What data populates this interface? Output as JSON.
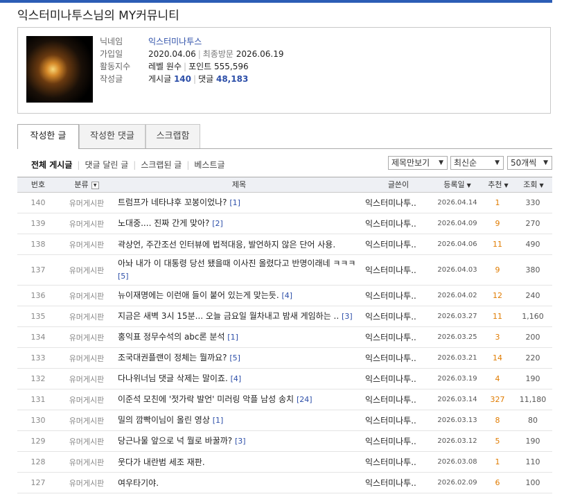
{
  "page_title": "익스터미나투스님의 MY커뮤니티",
  "profile": {
    "nickname_label": "닉네임",
    "nickname": "익스터미나투스",
    "joined_label": "가입일",
    "joined": "2020.04.06",
    "last_visit_label": "최종방문",
    "last_visit": "2026.06.19",
    "activity_label": "활동지수",
    "level_label": "레벨",
    "level": "원수",
    "points_label": "포인트",
    "points": "555,596",
    "writing_label": "작성글",
    "posts_label": "게시글",
    "posts": "140",
    "comments_label": "댓글",
    "comments": "48,183"
  },
  "tabs": [
    "작성한 글",
    "작성한 댓글",
    "스크랩함"
  ],
  "filters": [
    "전체 게시글",
    "댓글 달린 글",
    "스크랩된 글",
    "베스트글"
  ],
  "selects": {
    "view": "제목만보기",
    "sort": "최신순",
    "per_page": "50개씩"
  },
  "columns": {
    "num": "번호",
    "category": "분류",
    "title": "제목",
    "author": "글쓴이",
    "date": "등록일",
    "recommend": "추천",
    "views": "조회"
  },
  "rows": [
    {
      "num": "140",
      "category": "유머게시판",
      "title": "트럼프가 네타냐후 꼬봉이었나?",
      "comments": "[1]",
      "author": "익스터미나투..",
      "date": "2026.04.14",
      "rec": "1",
      "views": "330"
    },
    {
      "num": "139",
      "category": "유머게시판",
      "title": "노대중.... 진짜 간게 맞아?",
      "comments": "[2]",
      "author": "익스터미나투..",
      "date": "2026.04.09",
      "rec": "9",
      "views": "270"
    },
    {
      "num": "138",
      "category": "유머게시판",
      "title": "곽상언, 주간조선 인터뷰에 법적대응, 발언하지 않은 단어 사용.",
      "comments": "",
      "author": "익스터미나투..",
      "date": "2026.04.06",
      "rec": "11",
      "views": "490"
    },
    {
      "num": "137",
      "category": "유머게시판",
      "title": "아놔 내가 이 대통령 당선 됐을때 이사진 올렸다고 반명이래네 ㅋㅋㅋ",
      "comments": "[5]",
      "author": "익스터미나투..",
      "date": "2026.04.03",
      "rec": "9",
      "views": "380"
    },
    {
      "num": "136",
      "category": "유머게시판",
      "title": "뉴이재명에는 이런애 들이 붙어 있는게 맞는듯.",
      "comments": "[4]",
      "author": "익스터미나투..",
      "date": "2026.04.02",
      "rec": "12",
      "views": "240"
    },
    {
      "num": "135",
      "category": "유머게시판",
      "title": "지금은 새벽 3시 15분... 오늘 금요일 월차내고 밤새 게임하는 ..",
      "comments": "[3]",
      "author": "익스터미나투..",
      "date": "2026.03.27",
      "rec": "11",
      "views": "1,160"
    },
    {
      "num": "134",
      "category": "유머게시판",
      "title": "홍익표 정무수석의 abc론 분석",
      "comments": "[1]",
      "author": "익스터미나투..",
      "date": "2026.03.25",
      "rec": "3",
      "views": "200"
    },
    {
      "num": "133",
      "category": "유머게시판",
      "title": "조국대권플랜이 정체는 뭘까요?",
      "comments": "[5]",
      "author": "익스터미나투..",
      "date": "2026.03.21",
      "rec": "14",
      "views": "220"
    },
    {
      "num": "132",
      "category": "유머게시판",
      "title": "다나위너님 댓글 삭제는 말이죠.",
      "comments": "[4]",
      "author": "익스터미나투..",
      "date": "2026.03.19",
      "rec": "4",
      "views": "190"
    },
    {
      "num": "131",
      "category": "유머게시판",
      "title": "이준석 모친에 '젓가락 발언' 미러링 악플 남성 송치",
      "comments": "[24]",
      "author": "익스터미나투..",
      "date": "2026.03.14",
      "rec": "327",
      "views": "11,180"
    },
    {
      "num": "130",
      "category": "유머게시판",
      "title": "밀의 깜빡이님이 올린 영상",
      "comments": "[1]",
      "author": "익스터미나투..",
      "date": "2026.03.13",
      "rec": "8",
      "views": "80"
    },
    {
      "num": "129",
      "category": "유머게시판",
      "title": "당근나물 앞으로 넉 뭘로 바꿀까?",
      "comments": "[3]",
      "author": "익스터미나투..",
      "date": "2026.03.12",
      "rec": "5",
      "views": "190"
    },
    {
      "num": "128",
      "category": "유머게시판",
      "title": "웃다가 내란범 세조 재판.",
      "comments": "",
      "author": "익스터미나투..",
      "date": "2026.03.08",
      "rec": "1",
      "views": "110"
    },
    {
      "num": "127",
      "category": "유머게시판",
      "title": "여우타기야.",
      "comments": "",
      "author": "익스터미나투..",
      "date": "2026.02.09",
      "rec": "6",
      "views": "100"
    }
  ]
}
